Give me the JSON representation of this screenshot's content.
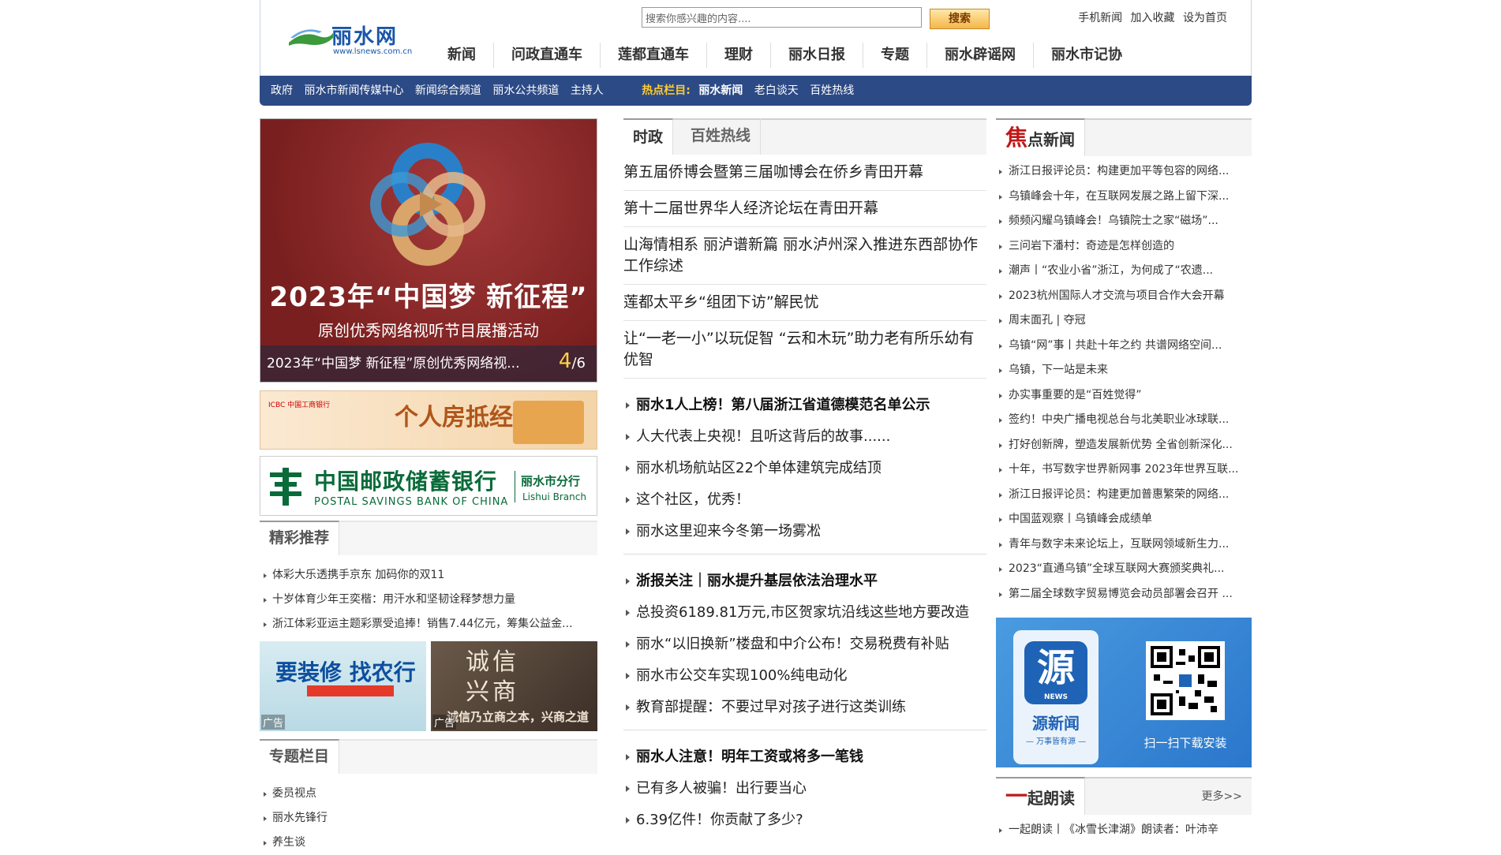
{
  "header": {
    "logo_name": "丽水网",
    "logo_url": "www.lsnews.com.cn",
    "search_placeholder": "搜索你感兴趣的内容....",
    "search_button": "搜索",
    "top_links": [
      "手机新闻",
      "加入收藏",
      "设为首页"
    ],
    "nav": [
      "新闻",
      "问政直通车",
      "莲都直通车",
      "理财",
      "丽水日报",
      "专题",
      "丽水辟谣网",
      "丽水市记协"
    ]
  },
  "subnav": {
    "items": [
      "政府",
      "丽水市新闻传媒中心",
      "新闻综合频道",
      "丽水公共频道",
      "主持人"
    ],
    "hot_label": "热点栏目:",
    "hot_items": [
      "丽水新闻",
      "老白谈天",
      "百姓热线"
    ]
  },
  "carousel": {
    "title": "2023年“中国梦 新征程”",
    "subtitle": "原创优秀网络视听节目展播活动",
    "caption": "2023年“中国梦 新征程”原创优秀网络视...",
    "current": "4",
    "total": "/6"
  },
  "ads": {
    "icbc_logo": "ICBC 中国工商银行",
    "icbc_title": "个人房抵经营贷",
    "psbc_cn": "中国邮政储蓄银行",
    "psbc_en": "POSTAL SAVINGS BANK OF CHINA",
    "psbc_branch": "丽水市分行",
    "psbc_branch_en": "Lishui Branch",
    "abc_title": "要装修 找农行",
    "cx_title": "诚信\n兴商",
    "cx_sub": "诚信乃立商之本，兴商之道",
    "ad_tag": "广告"
  },
  "featured": {
    "label": "精彩推荐",
    "items": [
      "体彩大乐透携手京东 加码你的双11",
      "十岁体育少年王奕楷：用汗水和坚韧诠释梦想力量",
      "浙江体彩亚运主题彩票受追捧！销售7.44亿元，筹集公益金..."
    ]
  },
  "special": {
    "label": "专题栏目",
    "items": [
      "委员视点",
      "丽水先锋行",
      "养生谈"
    ]
  },
  "middle": {
    "tabs": [
      "时政",
      "百姓热线"
    ],
    "headlines": [
      "第五届侨博会暨第三届咖博会在侨乡青田开幕",
      "第十二届世界华人经济论坛在青田开幕",
      "山海情相系 丽泸谱新篇 丽水泸州深入推进东西部协作工作综述",
      "莲都太平乡“组团下访”解民忧",
      "让“一老一小”以玩促智 “云和木玩”助力老有所乐幼有优智"
    ],
    "block1": [
      "丽水1人上榜！第八届浙江省道德模范名单公示",
      "人大代表上央视！且听这背后的故事......",
      "丽水机场航站区22个单体建筑完成结顶",
      "这个社区，优秀！",
      "丽水这里迎来今冬第一场雾凇"
    ],
    "block2": [
      "浙报关注｜丽水提升基层依法治理水平",
      "总投资6189.81万元,市区贺家坑沿线这些地方要改造",
      "丽水“以旧换新”楼盘和中介公布！交易税费有补贴",
      "丽水市公交车实现100%纯电动化",
      "教育部提醒：不要过早对孩子进行这类训练"
    ],
    "block3": [
      "丽水人注意！明年工资或将多一笔钱",
      "已有多人被骗！出行要当心",
      "6.39亿件！你贡献了多少?"
    ]
  },
  "focus": {
    "label_big": "焦",
    "label_rest": "点新闻",
    "items": [
      "浙江日报评论员：构建更加平等包容的网络...",
      "乌镇峰会十年，在互联网发展之路上留下深...",
      "频频闪耀乌镇峰会！乌镇院士之家“磁场”...",
      "三问岩下潘村：奇迹是怎样创造的",
      "潮声丨“农业小省”浙江，为何成了“农遗...",
      "2023杭州国际人才交流与项目合作大会开幕",
      "周末面孔 | 夺冠",
      "乌镇“网”事丨共赴十年之约 共谱网络空间...",
      "乌镇，下一站是未来",
      "办实事重要的是“百姓觉得”",
      "签约！中央广播电视总台与北美职业冰球联...",
      "打好创新牌，塑造发展新优势 全省创新深化...",
      "十年，书写数字世界新网事 2023年世界互联...",
      "浙江日报评论员：构建更加普惠繁荣的网络...",
      "中国蓝观察丨乌镇峰会成绩单",
      "青年与数字未来论坛上，互联网领域新生力...",
      "2023“直通乌镇”全球互联网大赛颁奖典礼...",
      "第二届全球数字贸易博览会动员部署会召开 ..."
    ]
  },
  "app_promo": {
    "icon_char": "源",
    "icon_sub": "NEWS",
    "app_name": "源新闻",
    "slogan": "— 万事皆有源 —",
    "qr_hint": "扫一扫下载安装"
  },
  "reading": {
    "label_big": "一",
    "label_rest": "起朗读",
    "more": "更多>>",
    "items": [
      "一起朗读丨《冰雪长津湖》朗读者：叶沛辛"
    ]
  }
}
